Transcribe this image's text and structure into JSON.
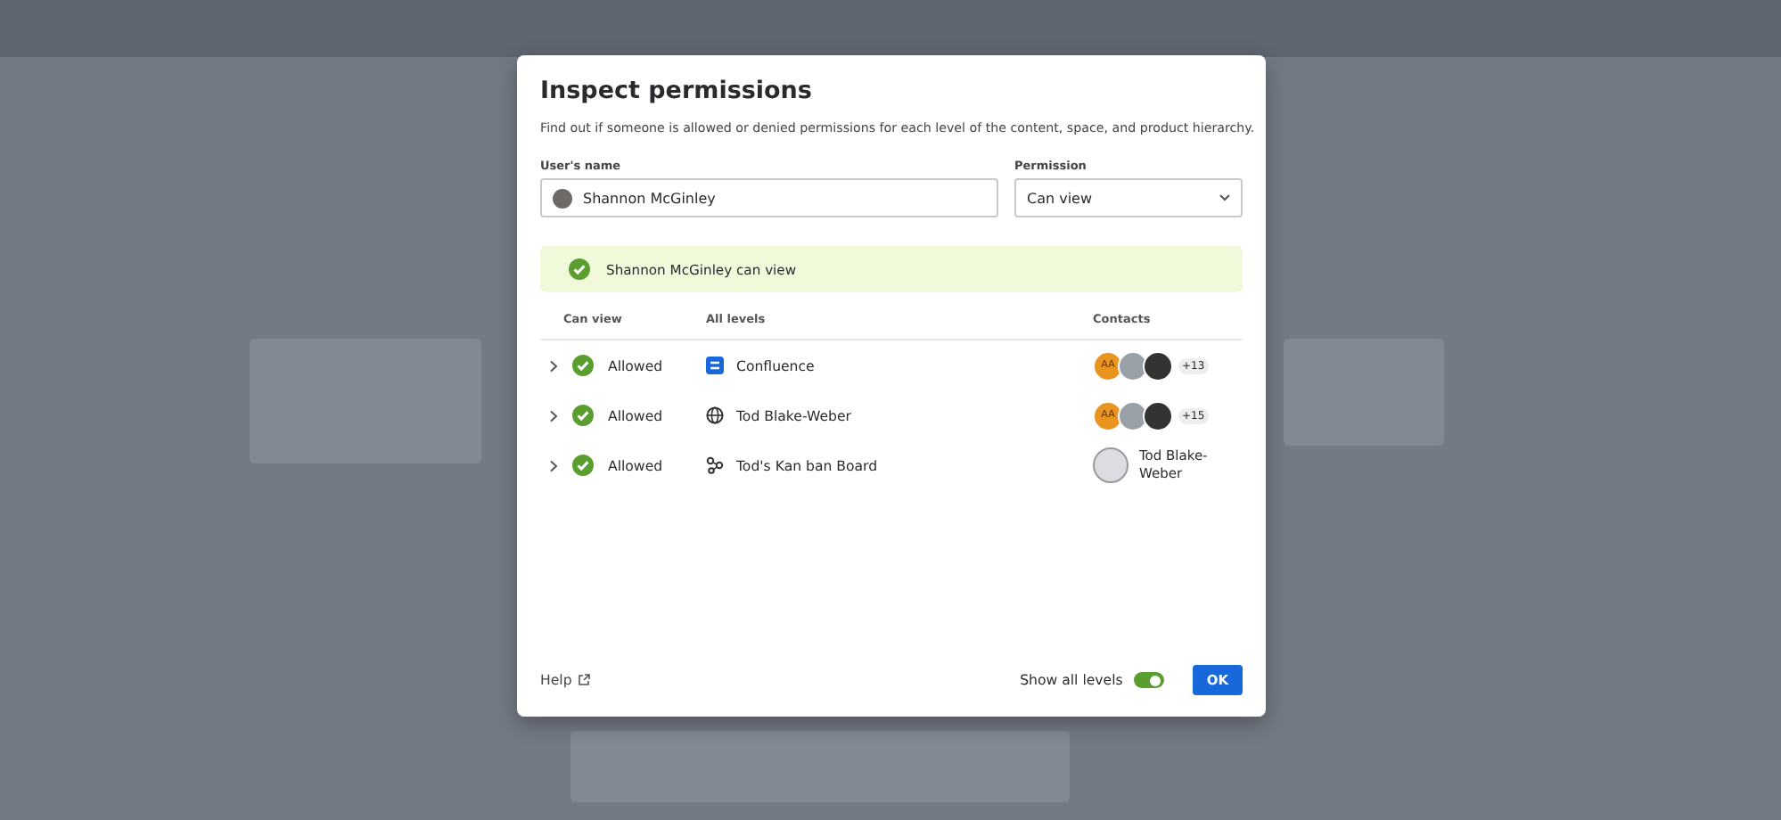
{
  "dialog": {
    "title": "Inspect permissions",
    "description": "Find out if someone is allowed or denied permissions for each level of the content, space, and product hierarchy.",
    "user_field": {
      "label": "User's name",
      "value": "Shannon McGinley"
    },
    "permission_field": {
      "label": "Permission",
      "value": "Can view"
    },
    "result": {
      "text": "Shannon McGinley can view"
    },
    "table": {
      "columns": [
        "Can view",
        "All levels",
        "Contacts"
      ],
      "rows": [
        {
          "expanded": false,
          "status": "Allowed",
          "level": "Confluence",
          "kind": "product",
          "contacts": {
            "kind": "avatars",
            "initials": "AA",
            "more": "+13"
          }
        },
        {
          "expanded": false,
          "status": "Allowed",
          "level": "Tod Blake-Weber",
          "kind": "space",
          "contacts": {
            "kind": "avatars",
            "initials": "AA",
            "more": "+15"
          }
        },
        {
          "expanded": false,
          "status": "Allowed",
          "level": "Tod's Kan ban Board",
          "kind": "board",
          "contacts": {
            "kind": "person",
            "name": "Tod Blake-Weber"
          }
        }
      ]
    },
    "footer": {
      "help": "Help",
      "toggle": {
        "label": "Show all levels",
        "on": true
      },
      "ok": "OK"
    }
  }
}
